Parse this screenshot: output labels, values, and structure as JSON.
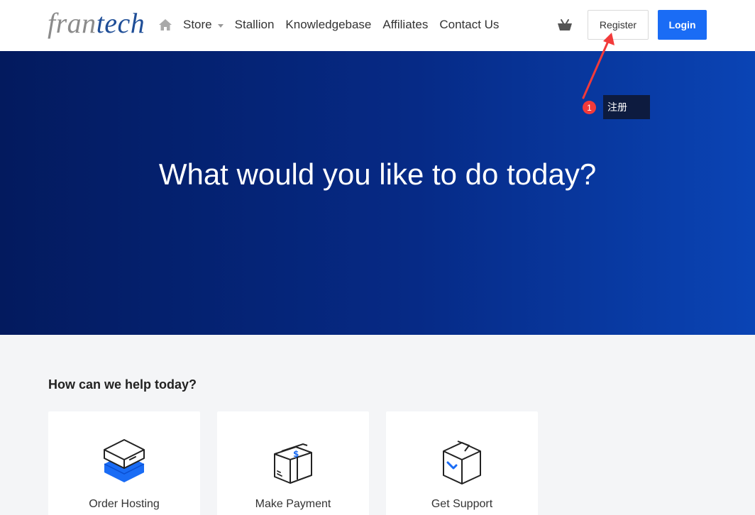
{
  "header": {
    "logo_part1": "fran",
    "logo_part2": "tech",
    "nav": {
      "store": "Store",
      "stallion": "Stallion",
      "knowledgebase": "Knowledgebase",
      "affiliates": "Affiliates",
      "contact": "Contact Us"
    },
    "register_label": "Register",
    "login_label": "Login"
  },
  "hero": {
    "title": "What would you like to do today?"
  },
  "annotation": {
    "badge": "1",
    "label": "注册",
    "color": "#f23a3a"
  },
  "help": {
    "heading": "How can we help today?",
    "cards": [
      {
        "label": "Order Hosting",
        "icon": "server-stack-icon"
      },
      {
        "label": "Make Payment",
        "icon": "payment-box-icon"
      },
      {
        "label": "Get Support",
        "icon": "support-box-icon"
      }
    ]
  },
  "colors": {
    "accent": "#1a6cf5",
    "hero_start": "#031a5e",
    "hero_end": "#0a44b5"
  }
}
